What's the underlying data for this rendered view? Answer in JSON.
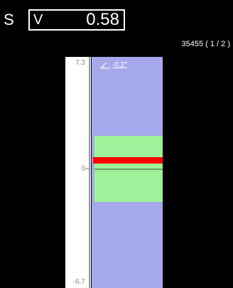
{
  "header": {
    "axis_letter": "S",
    "field_label": "V",
    "value": "0.58"
  },
  "counter": "35455 ( 1 / 2 )",
  "scale": {
    "top_label": "7.3",
    "zero_label": "0",
    "bottom_label": "-6.7"
  },
  "angle": {
    "icon": "angle-icon",
    "text": "-0.2°"
  },
  "colors": {
    "background": "#000000",
    "column": "#a6a8ec",
    "band": "#9ff29a",
    "marker": "#ff0000"
  }
}
